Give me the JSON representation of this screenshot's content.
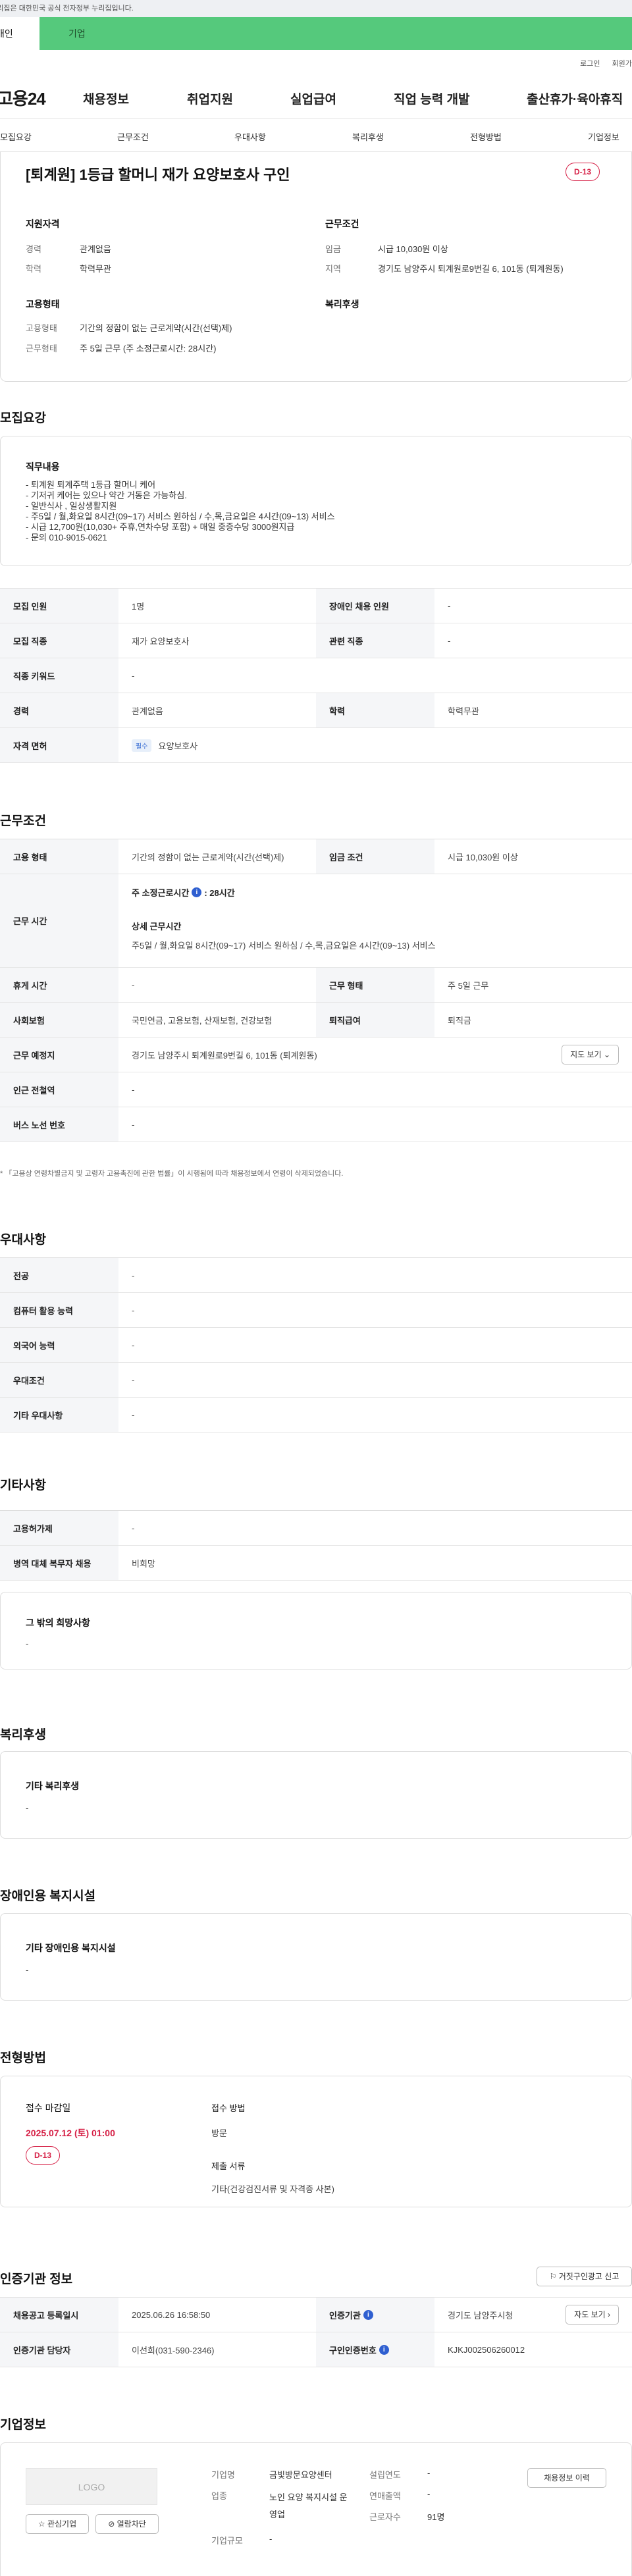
{
  "gov_banner": "이 누리집은 대한민국 공식 전자정부 누리집입니다.",
  "mode_tabs": {
    "personal": "개인",
    "company": "기업"
  },
  "util_links": {
    "login": "로그인",
    "signup": "회원가입"
  },
  "logo": "고용24",
  "gnb": [
    "채용정보",
    "취업지원",
    "실업급여",
    "직업 능력 개발",
    "출산휴가·육아휴직"
  ],
  "subnav": [
    "모집요강",
    "근무조건",
    "우대사항",
    "복리후생",
    "전형방법",
    "기업정보"
  ],
  "summary": {
    "title": "[퇴계원] 1등급 할머니 재가 요양보호사 구인",
    "dday": "D-13",
    "qualification_title": "지원자격",
    "career_label": "경력",
    "career_value": "관계없음",
    "education_label": "학력",
    "education_value": "학력무관",
    "employment_title": "고용형태",
    "emp_type_label": "고용형태",
    "emp_type_value": "기간의 정함이 없는 근로계약(시간(선택)제)",
    "work_type_label": "근무형태",
    "work_type_value": "주 5일 근무 (주 소정근로시간: 28시간)",
    "conditions_title": "근무조건",
    "wage_label": "임금",
    "wage_value": "시급 10,030원 이상",
    "region_label": "지역",
    "region_value": "경기도 남양주시 퇴계원로9번길 6, 101동 (퇴계원동)",
    "welfare_title": "복리후생"
  },
  "recruit": {
    "section_title": "모집요강",
    "duty_title": "직무내용",
    "duty_text": "- 퇴계원 퇴계주택 1등급 할머니 케어\n- 기저귀 케어는 있으나 약간 거동은 가능하심.\n- 일반식사 , 일상생활지원\n- 주5일 / 월,화요일 8시간(09~17) 서비스 원하심 / 수,목,금요일은 4시간(09~13) 서비스\n- 시급 12,700원(10,030+ 주휴,연차수당 포함) + 매일 중증수당 3000원지급\n- 문의 010-9015-0621",
    "rows": {
      "headcount_label": "모집 인원",
      "headcount_value": "1명",
      "disabled_label": "장애인 채용 인원",
      "disabled_value": "-",
      "job_label": "모집 직종",
      "job_value": "재가 요양보호사",
      "related_label": "관련 직종",
      "related_value": "-",
      "keyword_label": "직종 키워드",
      "keyword_value": "-",
      "career_label": "경력",
      "career_value": "관계없음",
      "education_label": "학력",
      "education_value": "학력무관",
      "license_label": "자격 면허",
      "license_badge": "필수",
      "license_value": "요양보호사"
    }
  },
  "work": {
    "section_title": "근무조건",
    "emp_type_label": "고용 형태",
    "emp_type_value": "기간의 정함이 없는 근로계약(시간(선택)제)",
    "wage_label": "임금 조건",
    "wage_value": "시급 10,030원 이상",
    "hours_label": "근무 시간",
    "weekly_hours_label": "주 소정근로시간",
    "weekly_hours_value": ": 28시간",
    "detail_hours_label": "상세 근무시간",
    "detail_hours_value": "주5일 / 월,화요일 8시간(09~17) 서비스 원하심 / 수,목,금요일은 4시간(09~13) 서비스",
    "break_label": "휴게 시간",
    "break_value": "-",
    "work_form_label": "근무 형태",
    "work_form_value": "주 5일 근무",
    "insurance_label": "사회보험",
    "insurance_value": "국민연금, 고용보험, 산재보험, 건강보험",
    "retire_label": "퇴직급여",
    "retire_value": "퇴직금",
    "place_label": "근무 예정지",
    "place_value": "경기도 남양주시 퇴계원로9번길 6, 101동 (퇴계원동)",
    "map_button": "지도 보기",
    "subway_label": "인근 전철역",
    "subway_value": "-",
    "bus_label": "버스 노선 번호",
    "bus_value": "-",
    "note": "* 「고용상 연령차별금지 및 고령자 고용촉진에 관한 법률」이 시행됨에 따라 채용정보에서 연령이 삭제되었습니다."
  },
  "preference": {
    "section_title": "우대사항",
    "major_label": "전공",
    "major_value": "-",
    "computer_label": "컴퓨터 활용 능력",
    "computer_value": "-",
    "language_label": "외국어 능력",
    "language_value": "-",
    "condition_label": "우대조건",
    "condition_value": "-",
    "other_label": "기타 우대사항",
    "other_value": "-"
  },
  "etc": {
    "section_title": "기타사항",
    "permit_label": "고용허가제",
    "permit_value": "-",
    "military_label": "병역 대체 복무자 채용",
    "military_value": "비희망",
    "other_wish_title": "그 밖의 희망사항",
    "other_wish_value": "-"
  },
  "welfare": {
    "section_title": "복리후생",
    "box_title": "기타 복리후생",
    "box_value": "-"
  },
  "disabled_facility": {
    "section_title": "장애인용 복지시설",
    "box_title": "기타 장애인용 복지시설",
    "box_value": "-"
  },
  "selection": {
    "section_title": "전형방법",
    "deadline_label": "접수 마감일",
    "deadline_value": "2025.07.12 (토) 01:00",
    "dday": "D-13",
    "method_label": "접수 방법",
    "method_value": "방문",
    "docs_label": "제출 서류",
    "docs_value": "기타(건강검진서류 및 자격증 사본)"
  },
  "cert": {
    "section_title": "인증기관 정보",
    "report_button": "거짓구인광고 신고",
    "reg_date_label": "채용공고 등록일시",
    "reg_date_value": "2025.06.26 16:58:50",
    "org_label": "인증기관",
    "org_value": "경기도 남양주시청",
    "detail_button": "자도 보기",
    "manager_label": "인증기관 담당자",
    "manager_value": "이선희(031-590-2346)",
    "cert_no_label": "구인인증번호",
    "cert_no_value": "KJKJ002506260012"
  },
  "company": {
    "section_title": "기업정보",
    "logo_placeholder": "LOGO",
    "fav_button": "관심기업",
    "block_button": "열람차단",
    "name_label": "기업명",
    "name_value": "금빛방문요양센터",
    "industry_label": "업종",
    "industry_value": "노인 요양 복지시설 운영업",
    "scale_label": "기업규모",
    "scale_value": "-",
    "founded_label": "설립연도",
    "founded_value": "-",
    "sales_label": "연매출액",
    "sales_value": "-",
    "employees_label": "근로자수",
    "employees_value": "91명",
    "history_button": "채용정보 이력"
  }
}
